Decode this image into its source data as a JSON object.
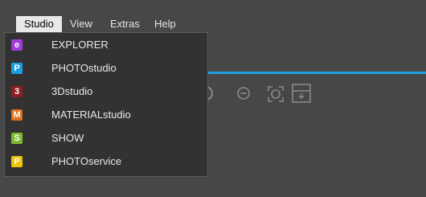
{
  "menubar": {
    "items": [
      {
        "label": "Studio"
      },
      {
        "label": "View"
      },
      {
        "label": "Extras"
      },
      {
        "label": "Help"
      }
    ]
  },
  "studio_menu": {
    "items": [
      {
        "label": "EXPLORER",
        "badge": "e",
        "color": "#a23bd8"
      },
      {
        "label": "PHOTOstudio",
        "badge": "P",
        "color": "#1a9fe0"
      },
      {
        "label": "3Dstudio",
        "badge": "3",
        "color": "#8f1d22"
      },
      {
        "label": "MATERIALstudio",
        "badge": "M",
        "color": "#e3701d"
      },
      {
        "label": "SHOW",
        "badge": "S",
        "color": "#7dbb2e"
      },
      {
        "label": "PHOTOservice",
        "badge": "P",
        "color": "#f0c400"
      }
    ]
  },
  "colors": {
    "background": "#474747",
    "dropdown_bg": "#323232",
    "accent_line": "#1e9ee0"
  },
  "toolbar": {
    "icons": [
      "rotate-icon",
      "minus-circle-icon",
      "fit-view-icon",
      "panel-icon"
    ]
  }
}
